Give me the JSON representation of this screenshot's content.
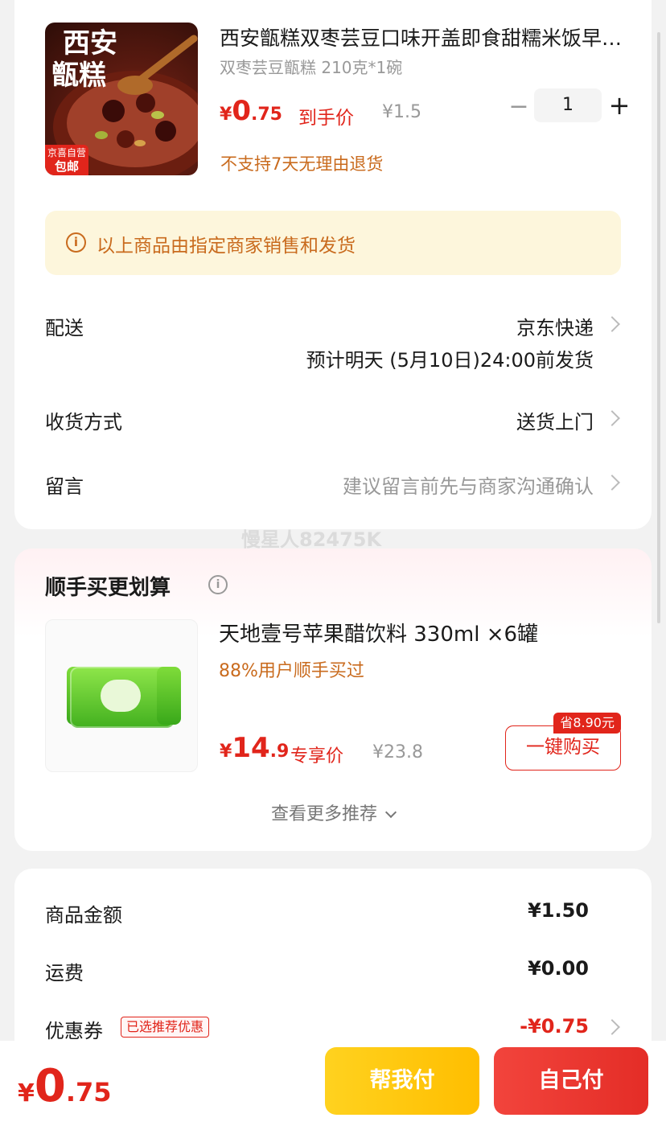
{
  "product": {
    "thumb_text_line1": "西安",
    "thumb_text_line2": "甑糕",
    "thumb_badge_line1": "京喜自营",
    "thumb_badge_line2": "包邮",
    "title": "西安甑糕双枣芸豆口味开盖即食甜糯米饭早餐传统糕点",
    "spec": "双枣芸豆甑糕 210克*1碗",
    "price_symbol": "¥",
    "price_int": "0",
    "price_dec": ".75",
    "price_tag": "到手价",
    "original_price": "¥1.5",
    "quantity": "1",
    "minus_symbol": "−",
    "plus_symbol": "+",
    "return_policy": "不支持7天无理由退货"
  },
  "notice": {
    "icon": "info-icon",
    "icon_glyph": "i",
    "text": "以上商品由指定商家销售和发货"
  },
  "delivery": {
    "label": "配送",
    "value": "京东快递",
    "eta": "预计明天 (5月10日)24:00前发货"
  },
  "receive": {
    "label": "收货方式",
    "value": "送货上门"
  },
  "message": {
    "label": "留言",
    "placeholder": "建议留言前先与商家沟通确认"
  },
  "watermark": "慢星人82475K",
  "recommend": {
    "title": "顺手买更划算",
    "info_glyph": "i",
    "item": {
      "title": "天地壹号苹果醋饮料 330ml ×6罐",
      "subtitle": "88%用户顺手买过",
      "price_symbol": "¥",
      "price_int": "14",
      "price_dec": ".9",
      "price_tag": "专享价",
      "original_price": "¥23.8",
      "save_badge": "省8.90元",
      "buy_label": "一键购买"
    },
    "more_label": "查看更多推荐"
  },
  "summary": {
    "goods_label": "商品金额",
    "goods_value": "¥1.50",
    "shipping_label": "运费",
    "shipping_value": "¥0.00",
    "coupon_label": "优惠券",
    "coupon_tag": "已选推荐优惠",
    "coupon_value": "-¥0.75"
  },
  "bottom": {
    "total_symbol": "¥",
    "total_int": "0",
    "total_dec": ".75",
    "help_pay_label": "帮我付",
    "self_pay_label": "自己付"
  },
  "colors": {
    "accent_red": "#e1251b",
    "notice_bg": "#fdf6dc",
    "notice_text": "#c96b1e",
    "help_button": "#ffc20e",
    "self_button": "#e8312b"
  }
}
